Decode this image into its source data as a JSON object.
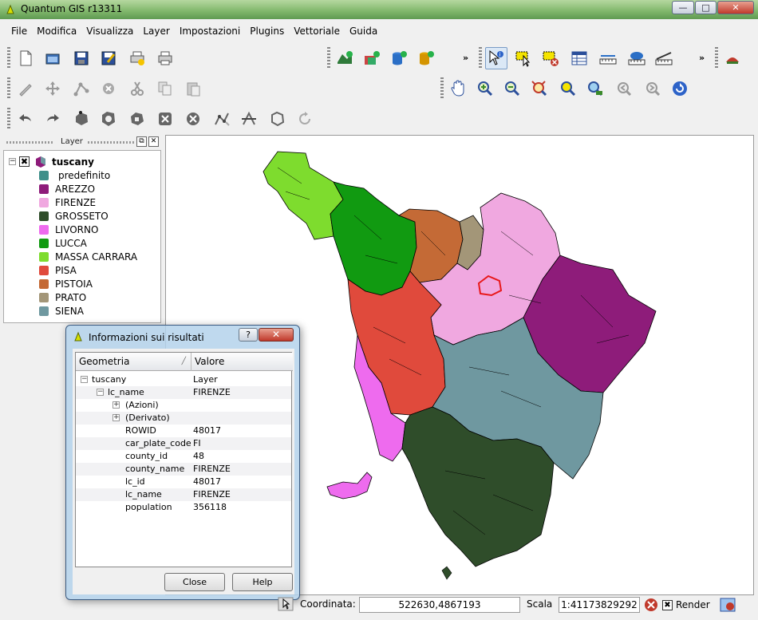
{
  "window": {
    "title": "Quantum GIS r13311",
    "controls": [
      "minimize",
      "maximize",
      "close"
    ]
  },
  "menu": [
    "File",
    "Modifica",
    "Visualizza",
    "Layer",
    "Impostazioni",
    "Plugins",
    "Vettoriale",
    "Guida"
  ],
  "toolbars": {
    "overflow_label": "»"
  },
  "layer_panel": {
    "title": "Layer",
    "root_layer": "tuscany",
    "legend": [
      {
        "label": "predefinito",
        "color": "#3f8f8a"
      },
      {
        "label": "AREZZO",
        "color": "#8e1c7a"
      },
      {
        "label": "FIRENZE",
        "color": "#f0a8e0"
      },
      {
        "label": "GROSSETO",
        "color": "#2f4d2a"
      },
      {
        "label": "LIVORNO",
        "color": "#ee6bee"
      },
      {
        "label": "LUCCA",
        "color": "#119a11"
      },
      {
        "label": "MASSA CARRARA",
        "color": "#7edc2e"
      },
      {
        "label": "PISA",
        "color": "#e04a3c"
      },
      {
        "label": "PISTOIA",
        "color": "#c46a36"
      },
      {
        "label": "PRATO",
        "color": "#a39678"
      },
      {
        "label": "SIENA",
        "color": "#6f98a0"
      }
    ]
  },
  "dialog": {
    "title": "Informazioni sui risultati",
    "help_glyph": "?",
    "close_glyph": "✕",
    "columns": [
      "Geometria",
      "Valore"
    ],
    "rows": [
      {
        "key": "tuscany",
        "value": "Layer",
        "indent": 0,
        "toggle": "−"
      },
      {
        "key": "lc_name",
        "value": "FIRENZE",
        "indent": 1,
        "toggle": "−"
      },
      {
        "key": "(Azioni)",
        "value": "",
        "indent": 2,
        "toggle": "+"
      },
      {
        "key": "(Derivato)",
        "value": "",
        "indent": 2,
        "toggle": "+"
      },
      {
        "key": "ROWID",
        "value": "48017",
        "indent": 2,
        "toggle": ""
      },
      {
        "key": "car_plate_code",
        "value": "FI",
        "indent": 2,
        "toggle": ""
      },
      {
        "key": "county_id",
        "value": "48",
        "indent": 2,
        "toggle": ""
      },
      {
        "key": "county_name",
        "value": "FIRENZE",
        "indent": 2,
        "toggle": ""
      },
      {
        "key": "lc_id",
        "value": "48017",
        "indent": 2,
        "toggle": ""
      },
      {
        "key": "lc_name",
        "value": "FIRENZE",
        "indent": 2,
        "toggle": ""
      },
      {
        "key": "population",
        "value": "356118",
        "indent": 2,
        "toggle": ""
      }
    ],
    "close_button": "Close",
    "help_button": "Help"
  },
  "statusbar": {
    "coord_label": "Coordinata:",
    "coord_value": "522630,4867193",
    "scale_label": "Scala",
    "scale_value": "1:41173829292",
    "render_label": "Render"
  }
}
